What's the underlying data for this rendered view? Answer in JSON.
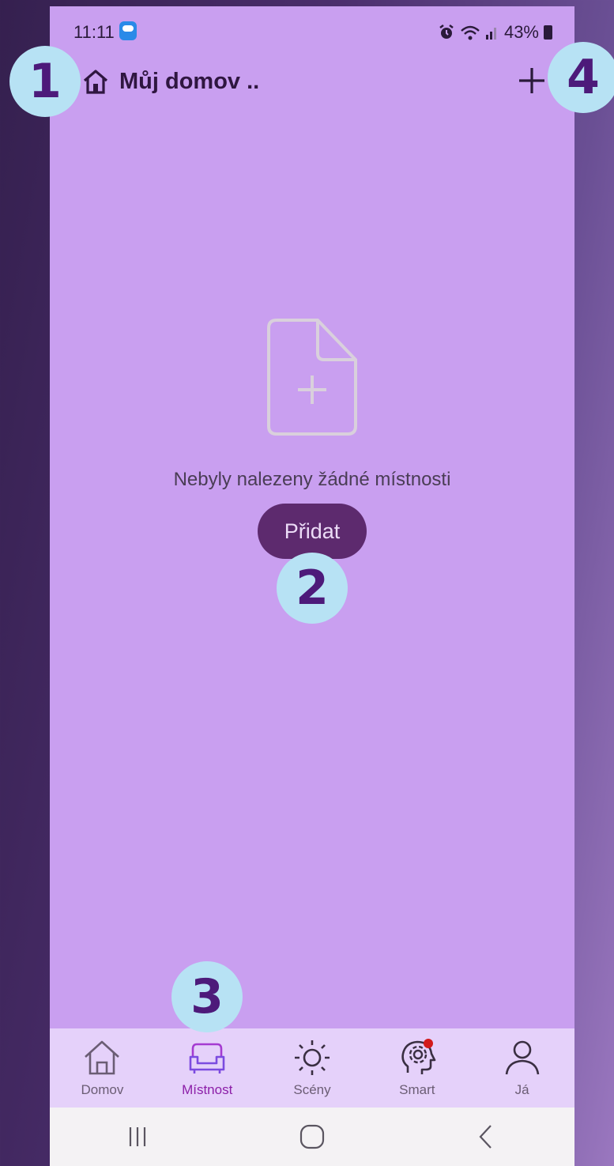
{
  "status_bar": {
    "time": "11:11",
    "battery": "43%"
  },
  "header": {
    "title": "Můj domov .."
  },
  "empty_state": {
    "message": "Nebyly nalezeny žádné místnosti",
    "add_label": "Přidat"
  },
  "callouts": [
    "1",
    "2",
    "3",
    "4"
  ],
  "tabs": [
    {
      "label": "Domov",
      "icon": "home-icon"
    },
    {
      "label": "Místnost",
      "icon": "armchair-icon",
      "active": true
    },
    {
      "label": "Scény",
      "icon": "sun-icon"
    },
    {
      "label": "Smart",
      "icon": "brain-gear-icon"
    },
    {
      "label": "Já",
      "icon": "person-icon"
    }
  ],
  "system_nav": [
    "recent-apps-icon",
    "home-circle-icon",
    "back-icon"
  ],
  "colors": {
    "screen_bg": "#c99ff0",
    "active_tab": "#8c1fa8",
    "add_button": "#5d2a6e",
    "callout_bg": "#b7e2f4",
    "callout_text": "#4d1a7a"
  }
}
